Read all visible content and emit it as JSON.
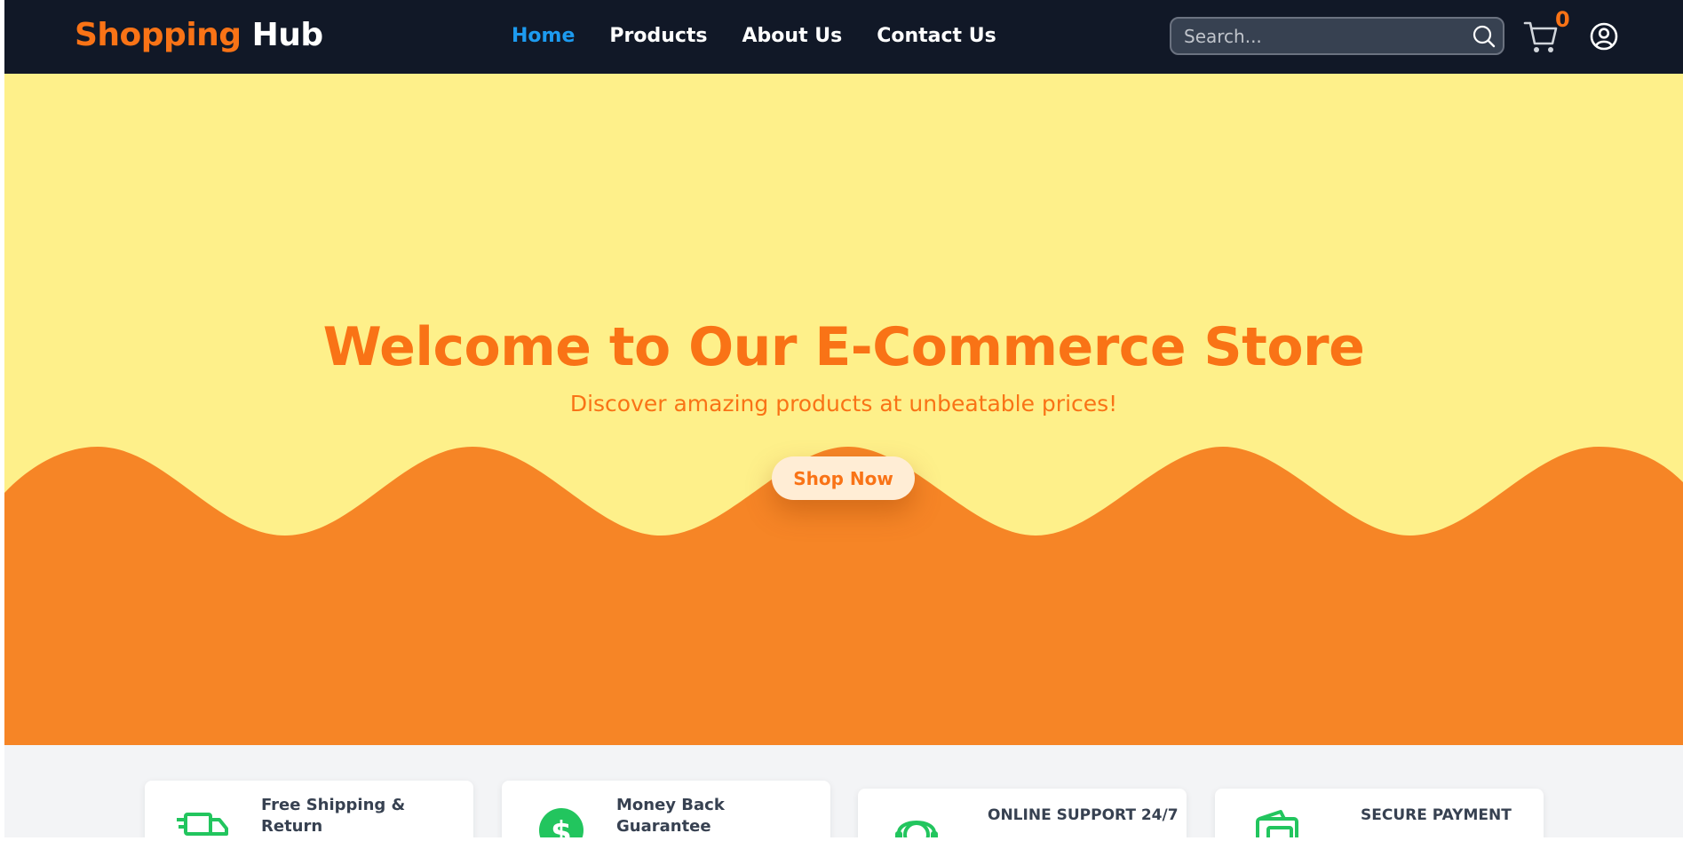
{
  "navbar": {
    "logo_part1": "Shopping",
    "logo_part2": "Hub",
    "links": [
      {
        "label": "Home",
        "active": true
      },
      {
        "label": "Products",
        "active": false
      },
      {
        "label": "About Us",
        "active": false
      },
      {
        "label": "Contact Us",
        "active": false
      }
    ],
    "search_placeholder": "Search...",
    "search_value": "",
    "cart_count": "0",
    "icons": [
      "search-icon",
      "cart-icon",
      "user-icon"
    ]
  },
  "hero": {
    "title": "Welcome to Our E-Commerce Store",
    "subtitle": "Discover amazing products at unbeatable prices!",
    "cta_label": "Shop Now"
  },
  "features": [
    {
      "title": "Free Shipping & Return",
      "icon": "truck-icon"
    },
    {
      "title": "Money Back Guarantee",
      "icon": "dollar-icon"
    },
    {
      "title": "ONLINE SUPPORT 24/7",
      "icon": "support-icon"
    },
    {
      "title": "SECURE PAYMENT",
      "icon": "wallet-icon"
    }
  ],
  "colors": {
    "nav_bg": "#111827",
    "brand_orange": "#f97316",
    "active_link": "#1d9bf0",
    "hero_yellow": "#fef08a",
    "wave_orange": "#f68526",
    "feature_green": "#22c55e",
    "section_gray": "#f3f4f6"
  }
}
